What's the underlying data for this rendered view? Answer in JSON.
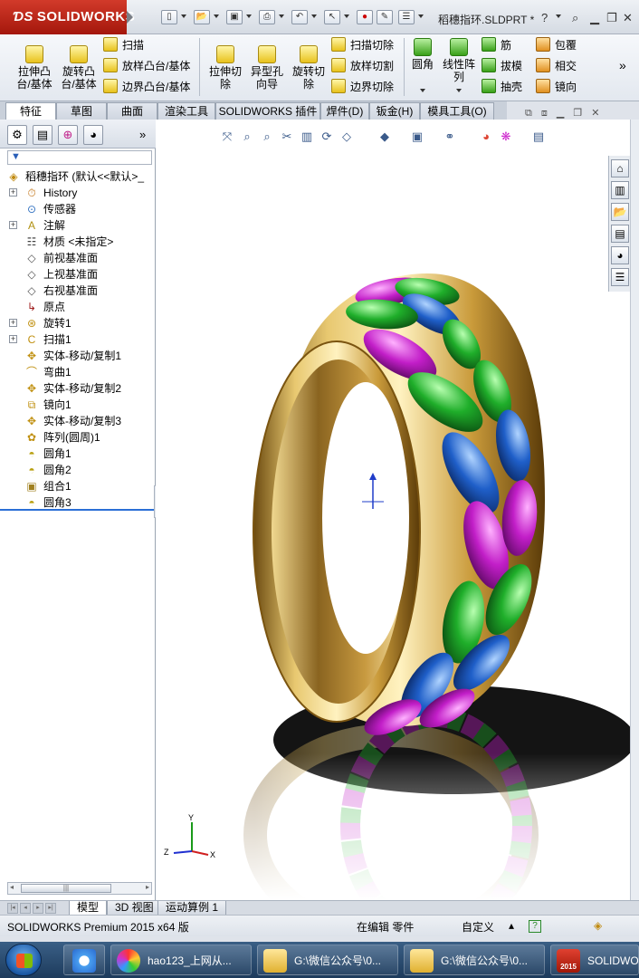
{
  "app": {
    "logo_text": "SOLIDWORKS",
    "doc_title": "稻穗指环.SLDPRT *",
    "help_glyph": "?"
  },
  "ribbon": {
    "extrude_boss": "拉伸凸\n台/基体",
    "revolve_boss": "旋转凸\n台/基体",
    "sweep": "扫描",
    "loft_boss": "放样凸台/基体",
    "boundary_boss": "边界凸台/基体",
    "extrude_cut": "拉伸切\n除",
    "hole_wizard": "异型孔\n向导",
    "revolve_cut": "旋转切\n除",
    "sweep_cut": "扫描切除",
    "loft_cut": "放样切割",
    "boundary_cut": "边界切除",
    "fillet": "圆角",
    "linear_pattern": "线性阵\n列",
    "rib": "筋",
    "draft": "拔模",
    "shell": "抽壳",
    "wrap": "包覆",
    "intersect": "相交",
    "mirror": "镜向",
    "more": "»"
  },
  "tabs": [
    {
      "label": "特征",
      "active": true
    },
    {
      "label": "草图"
    },
    {
      "label": "曲面"
    },
    {
      "label": "渲染工具"
    },
    {
      "label": "SOLIDWORKS 插件"
    },
    {
      "label": "焊件(D)"
    },
    {
      "label": "钣金(H)"
    },
    {
      "label": "模具工具(O)"
    }
  ],
  "panel": {
    "more": "»",
    "root": "稻穗指环 (默认<<默认>_",
    "items": [
      {
        "label": "History",
        "icon": "history-icon",
        "expand": true
      },
      {
        "label": "传感器",
        "icon": "sensor-icon",
        "expand": false
      },
      {
        "label": "注解",
        "icon": "annotation-icon",
        "expand": true
      },
      {
        "label": "材质 <未指定>",
        "icon": "material-icon",
        "expand": false
      },
      {
        "label": "前视基准面",
        "icon": "plane-icon",
        "expand": false
      },
      {
        "label": "上视基准面",
        "icon": "plane-icon",
        "expand": false
      },
      {
        "label": "右视基准面",
        "icon": "plane-icon",
        "expand": false
      },
      {
        "label": "原点",
        "icon": "origin-icon",
        "expand": false
      },
      {
        "label": "旋转1",
        "icon": "revolve-icon",
        "expand": true
      },
      {
        "label": "扫描1",
        "icon": "sweep-icon",
        "expand": true
      },
      {
        "label": "实体-移动/复制1",
        "icon": "move-copy-icon",
        "expand": false
      },
      {
        "label": "弯曲1",
        "icon": "flex-icon",
        "expand": false
      },
      {
        "label": "实体-移动/复制2",
        "icon": "move-copy-icon",
        "expand": false
      },
      {
        "label": "镜向1",
        "icon": "mirror-icon",
        "expand": false
      },
      {
        "label": "实体-移动/复制3",
        "icon": "move-copy-icon",
        "expand": false
      },
      {
        "label": "阵列(圆周)1",
        "icon": "circular-pattern-icon",
        "expand": false
      },
      {
        "label": "圆角1",
        "icon": "fillet-icon",
        "expand": false
      },
      {
        "label": "圆角2",
        "icon": "fillet-icon",
        "expand": false
      },
      {
        "label": "组合1",
        "icon": "combine-icon",
        "expand": false
      },
      {
        "label": "圆角3",
        "icon": "fillet-icon",
        "expand": false
      }
    ]
  },
  "triad": {
    "x": "X",
    "y": "Y",
    "z": "Z"
  },
  "model_tabs": [
    {
      "label": "模型",
      "active": true
    },
    {
      "label": "3D 视图"
    },
    {
      "label": "运动算例 1"
    }
  ],
  "status": {
    "product": "SOLIDWORKS Premium 2015 x64 版",
    "mode": "在编辑 零件",
    "units": "自定义",
    "units_caret": "▴"
  },
  "taskbar": {
    "items": [
      {
        "label": "hao123_上网从..."
      },
      {
        "label": "G:\\微信公众号\\0..."
      },
      {
        "label": "G:\\微信公众号\\0..."
      },
      {
        "label": "SOLIDWO"
      }
    ],
    "sw_badge": "2015"
  },
  "colors": {
    "gold": "#c9a24a",
    "magenta": "#c21ec8",
    "green": "#1fae2a",
    "blue": "#1f5fc9",
    "title_red": "#b8200f"
  }
}
